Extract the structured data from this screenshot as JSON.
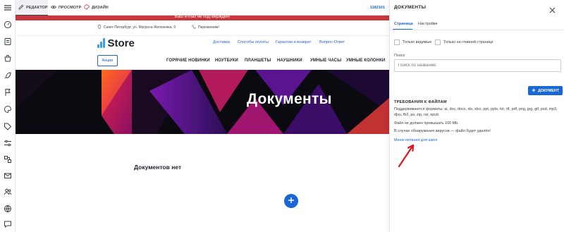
{
  "topbar": {
    "tabs": [
      {
        "label": "РЕДАКТОР",
        "icon": "edit-icon"
      },
      {
        "label": "ПРОСМОТР",
        "icon": "eye-icon"
      },
      {
        "label": "ДИЗАЙН",
        "icon": "palette-icon"
      }
    ],
    "site_id": "1182101"
  },
  "rail": {
    "icons": [
      "menu-icon",
      "dashboard-icon",
      "pages-icon",
      "shop-icon",
      "rocket-icon",
      "flag-icon",
      "palette-icon",
      "tag-icon",
      "sliders-icon",
      "integrations-icon",
      "mail-icon",
      "users-icon",
      "globe-icon",
      "chat-icon"
    ]
  },
  "preview": {
    "warning": "Ваш e-mail не подтверждён!",
    "address": "Санкт-Петербург, ул. Матроса Железняка, 9",
    "callback": "Перезвоним!",
    "logo": "Store",
    "top_links": [
      "Доставка",
      "Способы оплаты",
      "Гарантии и возврат",
      "Вопрос-Ответ"
    ],
    "promo_button": "Акции",
    "categories": [
      "ГОРЯЧИЕ НОВИНКИ",
      "НОУТБУКИ",
      "ПЛАНШЕТЫ",
      "НАУШНИКИ",
      "УМНЫЕ ЧАСЫ",
      "УМНЫЕ КОЛОНКИ"
    ],
    "hero_title": "Документы",
    "empty_text": "Документов нет",
    "colors": {
      "accent": "#1867d6",
      "warning": "#c7373d"
    }
  },
  "panel": {
    "title": "ДОКУМЕНТЫ",
    "tabs": [
      "Страница",
      "Настройки"
    ],
    "checkboxes": [
      "Только видимые",
      "Только на главной странице"
    ],
    "search_label": "Поиск",
    "search_placeholder": "Поиск по названию",
    "add_button": "ДОКУМЕНТ",
    "requirements_title": "ТРЕБОВАНИЯ К ФАЙЛАМ",
    "formats_text": "Поддерживаются форматы: ai, doc, docx, xls, xlsx, ppt, pptx, txt, rtf, pdf, png, jpg, gif, psd, mp3, djvu, fb2, ps, zip, rar, epub",
    "size_text": "Файл не должен превышать 100 Mb.",
    "virus_text": "В случае обнаружения вирусов — файл будет удалён!",
    "link_text": "Меню питания для школ"
  }
}
